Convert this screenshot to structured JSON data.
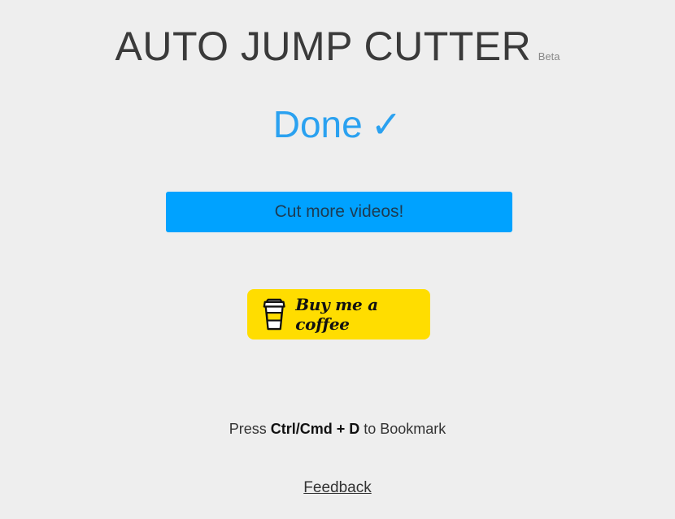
{
  "header": {
    "title": "AUTO JUMP CUTTER",
    "badge": "Beta"
  },
  "status": {
    "text": "Done",
    "icon_glyph": "✓",
    "icon": "checkmark-icon",
    "color": "#2aa1f0"
  },
  "actions": {
    "cut_more_label": "Cut more videos!",
    "cut_more_color": "#00a2ff",
    "coffee_label": "Buy me a coffee",
    "coffee_icon": "coffee-cup-icon",
    "coffee_color": "#ffdd00"
  },
  "bookmark": {
    "prefix": "Press",
    "shortcut": "Ctrl/Cmd + D",
    "suffix": "to Bookmark"
  },
  "footer": {
    "feedback_label": "Feedback"
  }
}
